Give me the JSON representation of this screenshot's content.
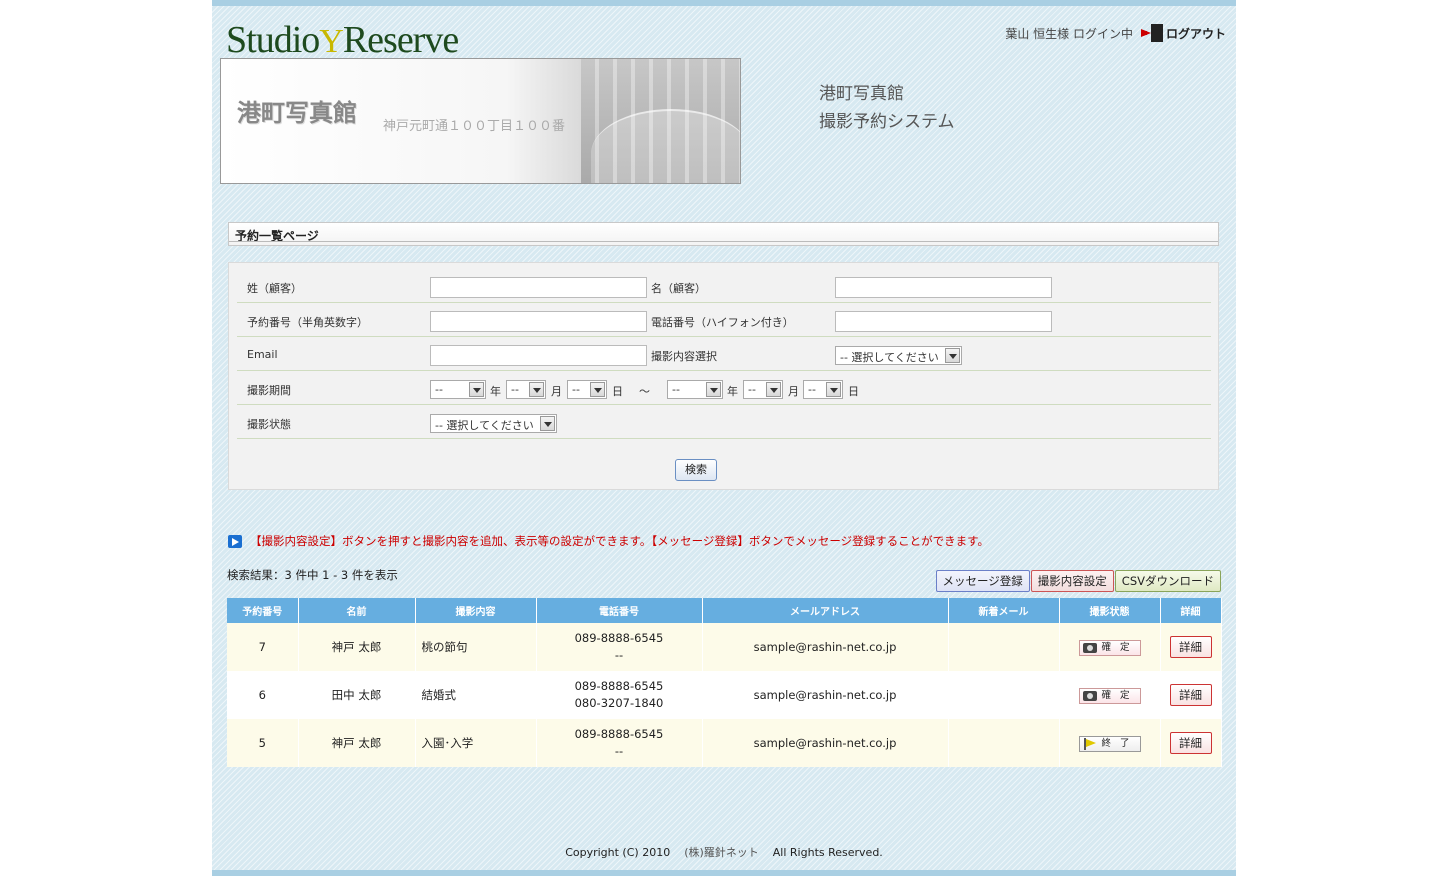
{
  "header": {
    "logo_left": "Studio",
    "logo_right": "Reserve",
    "user_status": "葉山 恒生様 ログイン中",
    "logout_label": "ログアウト"
  },
  "banner": {
    "studio_name": "港町写真館",
    "address": "神戸元町通１００丁目１００番"
  },
  "system_title": {
    "line1": "港町写真館",
    "line2": "撮影予約システム"
  },
  "page_title": "予約一覧ページ",
  "search": {
    "last_name_label": "姓（顧客）",
    "first_name_label": "名（顧客）",
    "reservation_no_label": "予約番号（半角英数字）",
    "phone_label": "電話番号（ハイフォン付き）",
    "email_label": "Email",
    "shoot_content_label": "撮影内容選択",
    "shoot_content_value": "-- 選択してください",
    "period_label": "撮影期間",
    "date_placeholder": "--",
    "year_unit": "年",
    "month_unit": "月",
    "day_unit": "日",
    "range_sep": "～",
    "status_label": "撮影状態",
    "status_value": "-- 選択してください",
    "search_button": "検索"
  },
  "notice": "【撮影内容設定】ボタンを押すと撮影内容を追加、表示等の設定ができます。【メッセージ登録】ボタンでメッセージ登録することができます。",
  "result_count": "検索結果：3 件中 1 - 3 件を表示",
  "buttons": {
    "message": "メッセージ登録",
    "content_settings": "撮影内容設定",
    "csv": "CSVダウンロード"
  },
  "table": {
    "headers": [
      "予約番号",
      "名前",
      "撮影内容",
      "電話番号",
      "メールアドレス",
      "新着メール",
      "撮影状態",
      "詳細"
    ],
    "rows": [
      {
        "no": "7",
        "name": "神戸 太郎",
        "content": "桃の節句",
        "phone1": "089-8888-6545",
        "phone2": "--",
        "email": "sample@rashin-net.co.jp",
        "new_mail": "",
        "status": "確 定",
        "detail": "詳細"
      },
      {
        "no": "6",
        "name": "田中 太郎",
        "content": "結婚式",
        "phone1": "089-8888-6545",
        "phone2": "080-3207-1840",
        "email": "sample@rashin-net.co.jp",
        "new_mail": "",
        "status": "確 定",
        "detail": "詳細"
      },
      {
        "no": "5",
        "name": "神戸 太郎",
        "content": "入園･入学",
        "phone1": "089-8888-6545",
        "phone2": "--",
        "email": "sample@rashin-net.co.jp",
        "new_mail": "",
        "status": "終 了",
        "detail": "詳細"
      }
    ]
  },
  "footer": {
    "copyright": "Copyright (C) 2010",
    "company": "(株)羅針ネット",
    "rights": "All Rights Reserved."
  },
  "colors": {
    "background": "#d7e9f1",
    "table_header": "#66aee0",
    "notice": "#cc0000"
  }
}
